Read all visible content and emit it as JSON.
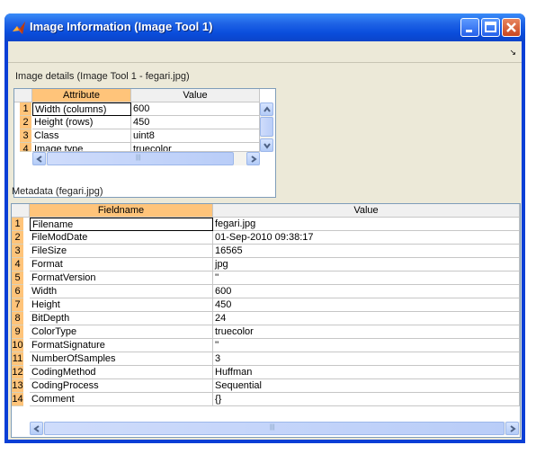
{
  "window": {
    "title": "Image Information (Image Tool 1)",
    "icon": "matlab-icon",
    "controls": [
      "minimize-icon",
      "maximize-icon",
      "close-icon"
    ]
  },
  "toolbar": {
    "undock_icon": "undock-arrow-icon",
    "undock_glyph": "↘"
  },
  "image_details": {
    "label": "Image details  (Image Tool 1 - fegari.jpg)",
    "columns": [
      "Attribute",
      "Value"
    ],
    "rows": [
      {
        "num": "1",
        "attribute": "Width (columns)",
        "value": "600"
      },
      {
        "num": "2",
        "attribute": "Height (rows)",
        "value": "450"
      },
      {
        "num": "3",
        "attribute": "Class",
        "value": "uint8"
      },
      {
        "num": "4",
        "attribute": "Image type",
        "value": "truecolor"
      }
    ]
  },
  "metadata": {
    "label": "Metadata (fegari.jpg)",
    "columns": [
      "Fieldname",
      "Value"
    ],
    "rows": [
      {
        "num": "1",
        "field": "Filename",
        "value": "fegari.jpg"
      },
      {
        "num": "2",
        "field": "FileModDate",
        "value": "01-Sep-2010 09:38:17"
      },
      {
        "num": "3",
        "field": "FileSize",
        "value": "16565"
      },
      {
        "num": "4",
        "field": "Format",
        "value": "jpg"
      },
      {
        "num": "5",
        "field": "FormatVersion",
        "value": "''"
      },
      {
        "num": "6",
        "field": "Width",
        "value": "600"
      },
      {
        "num": "7",
        "field": "Height",
        "value": "450"
      },
      {
        "num": "8",
        "field": "BitDepth",
        "value": "24"
      },
      {
        "num": "9",
        "field": "ColorType",
        "value": "truecolor"
      },
      {
        "num": "10",
        "field": "FormatSignature",
        "value": "''"
      },
      {
        "num": "11",
        "field": "NumberOfSamples",
        "value": "3"
      },
      {
        "num": "12",
        "field": "CodingMethod",
        "value": "Huffman"
      },
      {
        "num": "13",
        "field": "CodingProcess",
        "value": "Sequential"
      },
      {
        "num": "14",
        "field": "Comment",
        "value": "{}"
      }
    ]
  },
  "colors": {
    "title_bar": "#0a4ddc",
    "header_selected": "#ffc47a",
    "row_number": "#ffc47a",
    "client_bg": "#ece9d8"
  }
}
